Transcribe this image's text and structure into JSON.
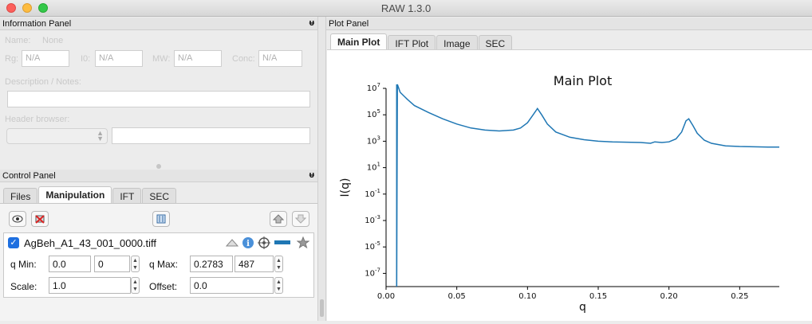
{
  "window": {
    "title": "RAW 1.3.0"
  },
  "info_panel": {
    "title": "Information Panel",
    "pin": "ᵾ",
    "name_label": "Name:",
    "name_value": "None",
    "rg_label": "Rg:",
    "rg_value": "N/A",
    "i0_label": "I0:",
    "i0_value": "N/A",
    "mw_label": "MW:",
    "mw_value": "N/A",
    "conc_label": "Conc:",
    "conc_value": "N/A",
    "desc_label": "Description / Notes:",
    "header_label": "Header browser:"
  },
  "control_panel": {
    "title": "Control Panel",
    "pin": "ᵾ",
    "tabs": [
      {
        "label": "Files",
        "active": false
      },
      {
        "label": "Manipulation",
        "active": true
      },
      {
        "label": "IFT",
        "active": false
      },
      {
        "label": "SEC",
        "active": false
      }
    ],
    "item": {
      "filename": "AgBeh_A1_43_001_0000.tiff",
      "checked": true,
      "qmin_label": "q Min:",
      "qmin_value": "0.0",
      "qmin_index": "0",
      "qmax_label": "q Max:",
      "qmax_value": "0.2783",
      "qmax_index": "487",
      "scale_label": "Scale:",
      "scale_value": "1.0",
      "offset_label": "Offset:",
      "offset_value": "0.0",
      "line_color": "#1f77b4"
    }
  },
  "plot_panel": {
    "title": "Plot Panel",
    "tabs": [
      {
        "label": "Main Plot",
        "active": true
      },
      {
        "label": "IFT Plot",
        "active": false
      },
      {
        "label": "Image",
        "active": false
      },
      {
        "label": "SEC",
        "active": false
      }
    ]
  },
  "chart_data": {
    "type": "line",
    "title": "Main Plot",
    "xlabel": "q",
    "ylabel": "I(q)",
    "yscale": "log",
    "xlim": [
      0,
      0.278
    ],
    "ylim": [
      1e-08,
      10000000.0
    ],
    "xticks": [
      "0.00",
      "0.05",
      "0.10",
      "0.15",
      "0.20",
      "0.25"
    ],
    "yticks": [
      "10^7",
      "10^5",
      "10^3",
      "10^1",
      "10^-1",
      "10^-3",
      "10^-5",
      "10^-7"
    ],
    "series": [
      {
        "color": "#1f77b4",
        "x": [
          0.0075,
          0.008,
          0.01,
          0.015,
          0.02,
          0.03,
          0.04,
          0.05,
          0.06,
          0.07,
          0.08,
          0.09,
          0.095,
          0.1,
          0.104,
          0.107,
          0.11,
          0.114,
          0.12,
          0.13,
          0.14,
          0.15,
          0.16,
          0.17,
          0.18,
          0.187,
          0.19,
          0.195,
          0.2,
          0.205,
          0.209,
          0.212,
          0.214,
          0.217,
          0.22,
          0.225,
          0.23,
          0.24,
          0.25,
          0.26,
          0.27,
          0.278
        ],
        "y": [
          1e-08,
          20000000.0,
          5000000.0,
          1500000.0,
          500000.0,
          150000.0,
          50000.0,
          20000.0,
          10000.0,
          7000,
          6000,
          7000,
          10000.0,
          25000.0,
          100000.0,
          300000.0,
          100000.0,
          20000.0,
          5000,
          2000,
          1300,
          1000,
          900,
          850,
          800,
          700,
          900,
          800,
          900,
          1500,
          5000,
          35000.0,
          50000.0,
          15000.0,
          4000,
          1200,
          700,
          450,
          400,
          380,
          360,
          360
        ]
      },
      {
        "color": "#1f77b4",
        "x": [
          0.0075,
          0.0075
        ],
        "y": [
          1e-08,
          20000000.0
        ]
      }
    ]
  }
}
